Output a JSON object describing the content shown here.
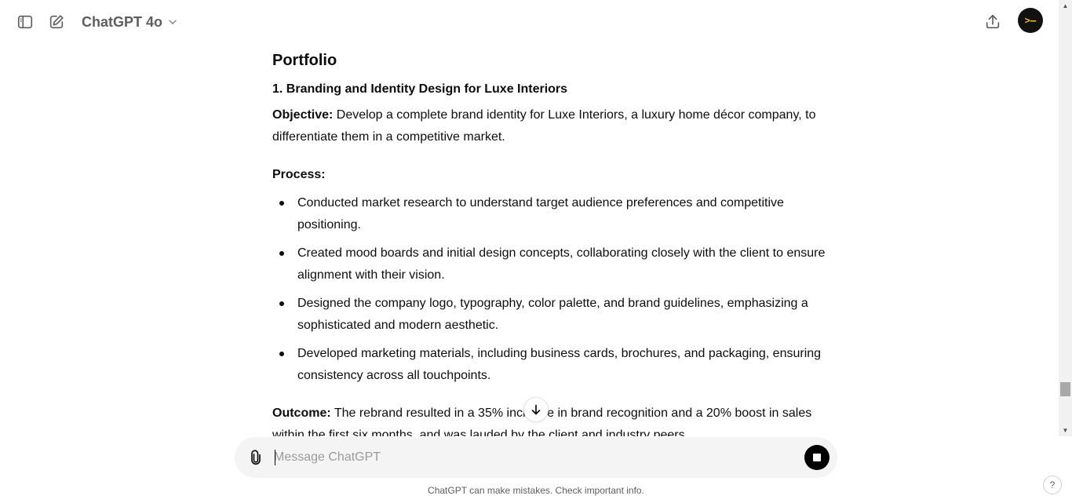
{
  "header": {
    "model_name": "ChatGPT 4o",
    "avatar_text": ">—",
    "icons": {
      "sidebar_toggle": "sidebar-toggle-icon",
      "new_chat": "new-chat-icon",
      "model_dropdown": "chevron-down-icon",
      "share": "share-icon"
    }
  },
  "content": {
    "section_title": "Portfolio",
    "item_title": "1. Branding and Identity Design for Luxe Interiors",
    "objective_label": "Objective:",
    "objective_text": " Develop a complete brand identity for Luxe Interiors, a luxury home décor company, to differentiate them in a competitive market.",
    "process_label": "Process:",
    "process_items": [
      "Conducted market research to understand target audience preferences and competitive positioning.",
      "Created mood boards and initial design concepts, collaborating closely with the client to ensure alignment with their vision.",
      "Designed the company logo, typography, color palette, and brand guidelines, emphasizing a sophisticated and modern aesthetic.",
      "Developed marketing materials, including business cards, brochures, and packaging, ensuring consistency across all touchpoints."
    ],
    "outcome_label": "Outcome:",
    "outcome_text": " The rebrand resulted in a 35% increase in brand recognition and a 20% boost in sales within the first six months, and was lauded by the client and industry peers."
  },
  "composer": {
    "placeholder": "Message ChatGPT",
    "value": ""
  },
  "footer": {
    "disclaimer": "ChatGPT can make mistakes. Check important info.",
    "help_label": "?"
  },
  "colors": {
    "text": "#0d0d0d",
    "muted": "#5d5d5d",
    "composer_bg": "#f4f4f4",
    "stop_button": "#000000"
  }
}
